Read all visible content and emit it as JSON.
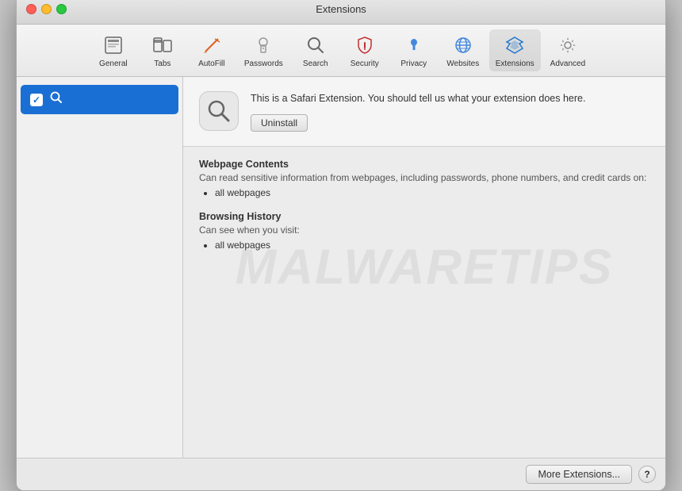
{
  "window": {
    "title": "Extensions"
  },
  "titlebar": {
    "buttons": {
      "close": "close",
      "minimize": "minimize",
      "maximize": "maximize"
    },
    "title": "Extensions"
  },
  "toolbar": {
    "items": [
      {
        "id": "general",
        "label": "General",
        "icon": "📄"
      },
      {
        "id": "tabs",
        "label": "Tabs",
        "icon": "🗂"
      },
      {
        "id": "autofill",
        "label": "AutoFill",
        "icon": "✏️"
      },
      {
        "id": "passwords",
        "label": "Passwords",
        "icon": "🔑"
      },
      {
        "id": "search",
        "label": "Search",
        "icon": "🔍"
      },
      {
        "id": "security",
        "label": "Security",
        "icon": "🔒"
      },
      {
        "id": "privacy",
        "label": "Privacy",
        "icon": "🤚"
      },
      {
        "id": "websites",
        "label": "Websites",
        "icon": "🌐"
      },
      {
        "id": "extensions",
        "label": "Extensions",
        "icon": "⚡"
      },
      {
        "id": "advanced",
        "label": "Advanced",
        "icon": "⚙️"
      }
    ]
  },
  "sidebar": {
    "items": [
      {
        "id": "search-ext",
        "label": "Search",
        "checked": true,
        "selected": true
      }
    ]
  },
  "detail": {
    "extension_icon": "🔍",
    "description": "This is a Safari Extension. You should tell us what your extension does here.",
    "uninstall_label": "Uninstall",
    "permissions": [
      {
        "title": "Webpage Contents",
        "description": "Can read sensitive information from webpages, including passwords, phone numbers, and credit cards on:",
        "items": [
          "all webpages"
        ]
      },
      {
        "title": "Browsing History",
        "description": "Can see when you visit:",
        "items": [
          "all webpages"
        ]
      }
    ]
  },
  "footer": {
    "more_extensions_label": "More Extensions...",
    "help_label": "?"
  },
  "watermark": {
    "text": "MALWARETIPS"
  }
}
